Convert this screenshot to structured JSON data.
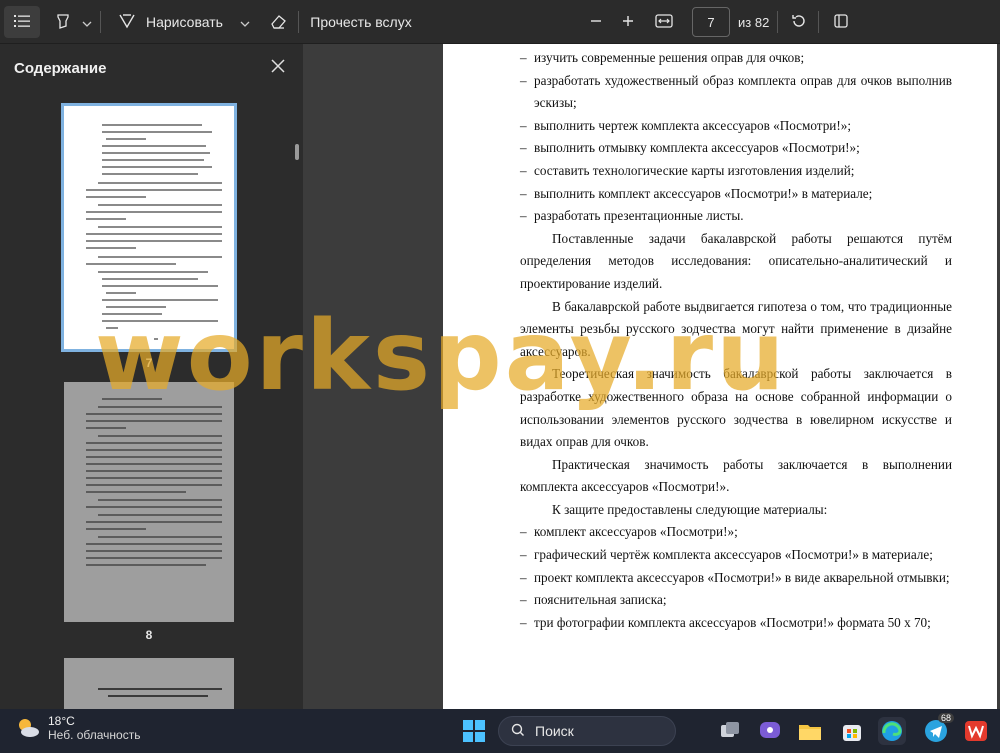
{
  "toolbar": {
    "draw_label": "Нарисовать",
    "read_aloud_label": "Прочесть вслух",
    "page_current": "7",
    "page_total": "из 82"
  },
  "sidebar": {
    "title": "Содержание",
    "thumbnails": [
      {
        "label": "7",
        "selected": true
      },
      {
        "label": "8",
        "selected": false
      }
    ]
  },
  "document": {
    "bullets_top": [
      "изучить современные решения оправ для очков;",
      "разработать художественный образ комплекта оправ для очков выполнив эскизы;",
      "выполнить чертеж комплекта аксессуаров «Посмотри!»;",
      "выполнить отмывку комплекта аксессуаров «Посмотри!»;",
      "составить технологические карты изготовления изделий;",
      "выполнить комплект аксессуаров «Посмотри!» в материале;",
      "разработать презентационные листы."
    ],
    "paragraphs": [
      "Поставленные задачи бакалаврской работы решаются путём определения методов исследования: описательно-аналитический и проектирование изделий.",
      "В бакалаврской работе выдвигается гипотеза о том, что традиционные элементы резьбы русского зодчества могут найти применение в дизайне аксессуаров.",
      "Теоретическая значимость бакалаврской работы заключается в разработке художественного образа на основе собранной информации о использовании элементов русского зодчества в ювелирном искусстве и видах оправ для очков.",
      "Практическая значимость работы заключается в выполнении комплекта аксессуаров «Посмотри!».",
      "К защите предоставлены следующие материалы:"
    ],
    "bullets_bottom": [
      "комплект аксессуаров «Посмотри!»;",
      "графический чертёж комплекта аксессуаров «Посмотри!» в материале;",
      "проект комплекта аксессуаров «Посмотри!» в виде акварельной отмывки;",
      "пояснительная записка;",
      "три фотографии комплекта аксессуаров «Посмотри!» формата 50 х 70;"
    ]
  },
  "watermark": "workspay.ru",
  "taskbar": {
    "temperature": "18°C",
    "condition": "Неб. облачность",
    "search_label": "Поиск",
    "telegram_badge": "68"
  },
  "colors": {
    "accent_selection": "#7fb2e0",
    "watermark": "#e6aa28",
    "taskbar": "#1f2430"
  }
}
